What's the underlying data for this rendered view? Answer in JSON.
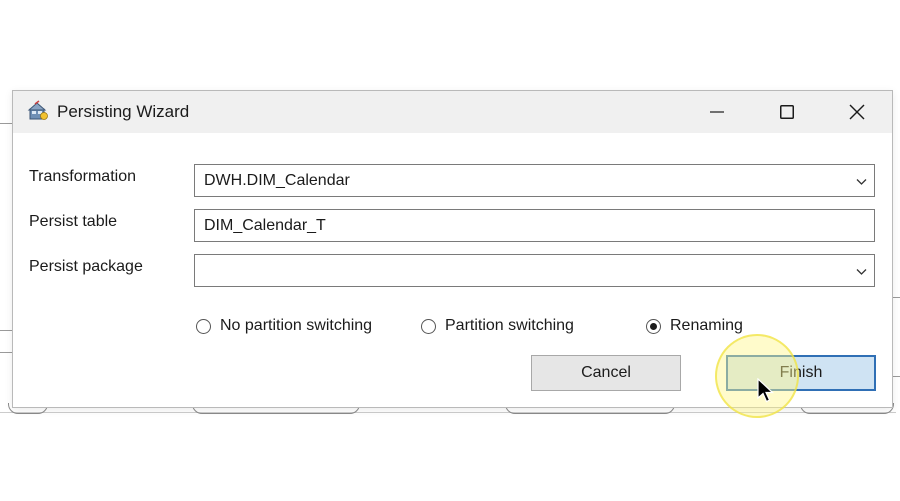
{
  "window": {
    "title": "Persisting Wizard",
    "controls": {
      "minimize_icon": "minimize-icon",
      "maximize_icon": "maximize-icon",
      "close_icon": "close-icon"
    }
  },
  "form": {
    "transformation": {
      "label": "Transformation",
      "value": "DWH.DIM_Calendar"
    },
    "persist_table": {
      "label": "Persist table",
      "value": "DIM_Calendar_T"
    },
    "persist_package": {
      "label": "Persist package",
      "value": ""
    }
  },
  "options": [
    {
      "label": "No partition switching",
      "checked": false
    },
    {
      "label": "Partition switching",
      "checked": false
    },
    {
      "label": "Renaming",
      "checked": true
    }
  ],
  "buttons": {
    "cancel": "Cancel",
    "finish": "Finish"
  },
  "colors": {
    "finish_bg": "#cfe3f3",
    "finish_border": "#2f6fb5",
    "highlight": "#fff78c"
  }
}
